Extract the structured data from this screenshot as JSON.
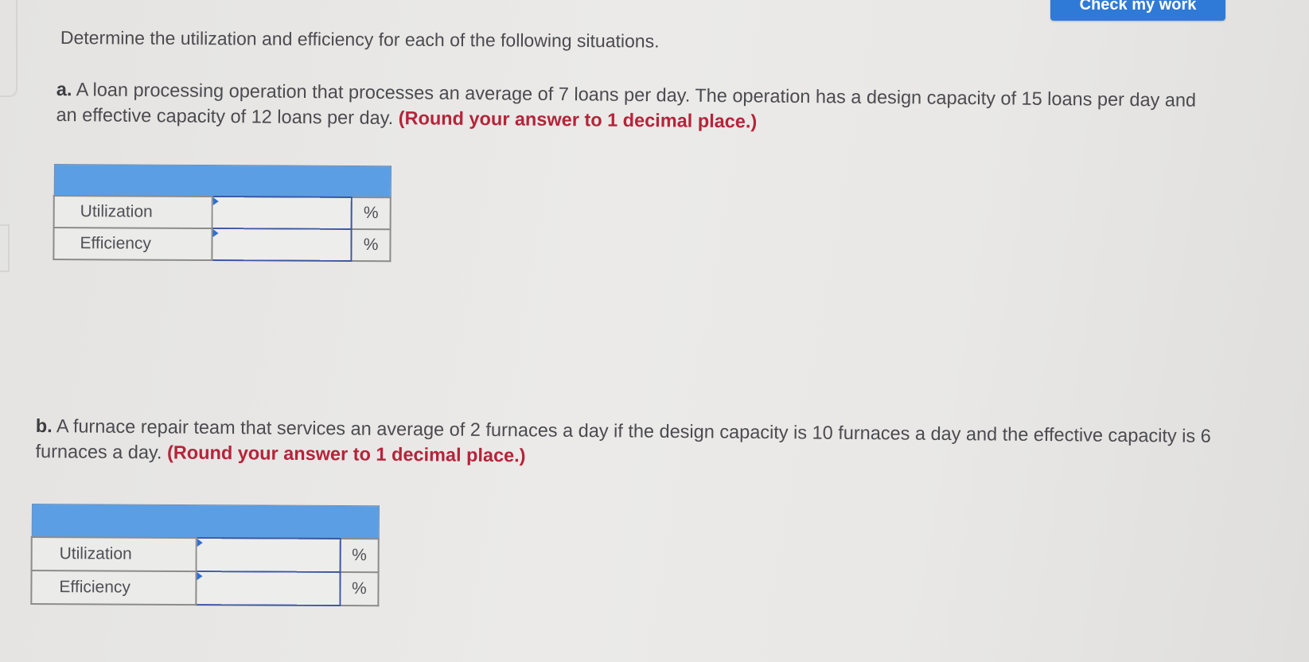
{
  "header": {
    "check_button_label": "Check my work",
    "accent_color": "#2f7ad6"
  },
  "instruction": "Determine the utilization and efficiency for each of the following situations.",
  "problems": [
    {
      "letter": "a.",
      "text": " A loan processing operation that processes an average of 7 loans per day. The operation has a design capacity of 15 loans per day and an effective capacity of 12 loans per day. ",
      "note": "(Round your answer to 1 decimal place.)",
      "rows": [
        {
          "label": "Utilization",
          "value": "",
          "unit": "%"
        },
        {
          "label": "Efficiency",
          "value": "",
          "unit": "%"
        }
      ]
    },
    {
      "letter": "b.",
      "text": " A furnace repair team that services an average of 2 furnaces a day if the design capacity is 10 furnaces a day and the effective capacity is 6 furnaces a day. ",
      "note": "(Round your answer to 1 decimal place.)",
      "rows": [
        {
          "label": "Utilization",
          "value": "",
          "unit": "%"
        },
        {
          "label": "Efficiency",
          "value": "",
          "unit": "%"
        }
      ]
    }
  ],
  "colors": {
    "table_header": "#5b9ee3",
    "note_red": "#b5243a",
    "input_border": "#3d56a3"
  }
}
